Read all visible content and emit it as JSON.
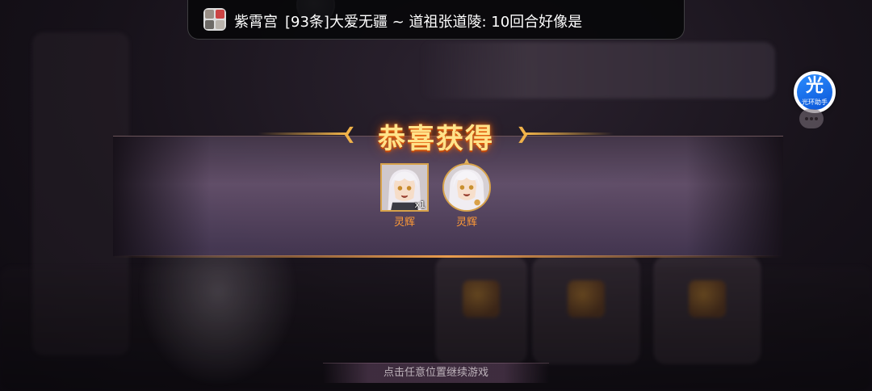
{
  "notification": {
    "sender": "紫霄宫",
    "message": "[93条]大爱无疆 ~ 道祖张道陵: 10回合好像是"
  },
  "assistant": {
    "icon_char": "光",
    "label": "光环助手"
  },
  "reward_popup": {
    "title": "恭喜获得",
    "items": [
      {
        "label": "灵辉",
        "quantity": "x1",
        "frame": "square"
      },
      {
        "label": "灵辉",
        "quantity": "",
        "frame": "round"
      }
    ],
    "continue_hint": "点击任意位置继续游戏"
  },
  "colors": {
    "title_gold": "#ffe38a",
    "item_label_orange": "#ff9a36",
    "frame_gold": "#d7a24b",
    "assistant_blue": "#1470ee"
  }
}
